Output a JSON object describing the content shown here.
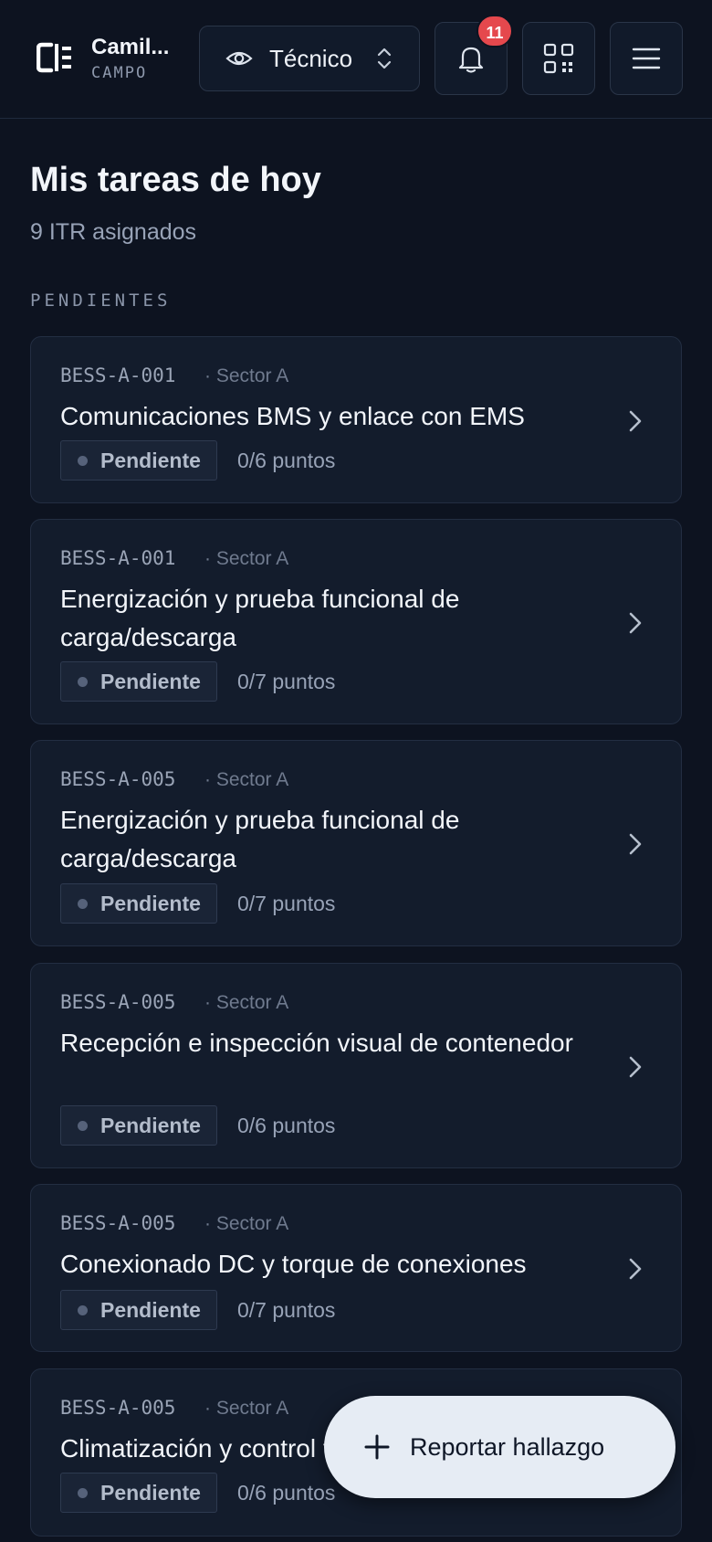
{
  "header": {
    "user_name": "Camil...",
    "user_role": "CAMPO",
    "role_selector": "Técnico",
    "notification_count": "11"
  },
  "main": {
    "title": "Mis tareas de hoy",
    "subtitle": "9 ITR asignados",
    "section_label": "PENDIENTES",
    "tasks": [
      {
        "code": "BESS-A-001",
        "sector": "· Sector A",
        "title": "Comunicaciones BMS y enlace con EMS",
        "status": "Pendiente",
        "points": "0/6 puntos"
      },
      {
        "code": "BESS-A-001",
        "sector": "· Sector A",
        "title": "Energización y prueba funcional de carga/descarga",
        "status": "Pendiente",
        "points": "0/7 puntos"
      },
      {
        "code": "BESS-A-005",
        "sector": "· Sector A",
        "title": "Energización y prueba funcional de carga/descarga",
        "status": "Pendiente",
        "points": "0/7 puntos"
      },
      {
        "code": "BESS-A-005",
        "sector": "· Sector A",
        "title": "Recepción e inspección visual de contenedor",
        "status": "Pendiente",
        "points": "0/6 puntos"
      },
      {
        "code": "BESS-A-005",
        "sector": "· Sector A",
        "title": "Conexionado DC y torque de conexiones",
        "status": "Pendiente",
        "points": "0/7 puntos"
      },
      {
        "code": "BESS-A-005",
        "sector": "· Sector A",
        "title": "Climatización y control térmico",
        "status": "Pendiente",
        "points": "0/6 puntos"
      }
    ]
  },
  "fab": {
    "label": "Reportar hallazgo"
  },
  "icons": {
    "logo": "brand-logo-icon",
    "role": "eye-icon",
    "role_toggle": "chevron-up-down-icon",
    "notifications": "bell-icon",
    "scan": "qr-code-icon",
    "menu": "hamburger-menu-icon",
    "task_open": "chevron-right-icon",
    "fab": "plus-icon"
  },
  "colors": {
    "background": "#0d1320",
    "card": "#131c2c",
    "badge": "#e5484d",
    "fab": "#e6ecf4"
  }
}
